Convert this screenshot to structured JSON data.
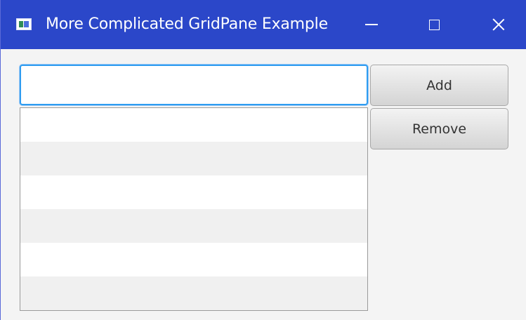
{
  "window": {
    "title": "More Complicated GridPane Example",
    "icon": "app-icon",
    "controls": [
      "minimize-icon",
      "maximize-icon",
      "close-icon"
    ]
  },
  "form": {
    "input_value": "",
    "add_label": "Add",
    "remove_label": "Remove"
  },
  "list": {
    "items": [
      "",
      "",
      "",
      "",
      "",
      ""
    ]
  },
  "colors": {
    "titlebar": "#2b47c9",
    "focus": "#2e9cf0",
    "button_top": "#f3f3f3",
    "button_bottom": "#d4d4d4",
    "list_alt_row": "#f0f0f0"
  }
}
